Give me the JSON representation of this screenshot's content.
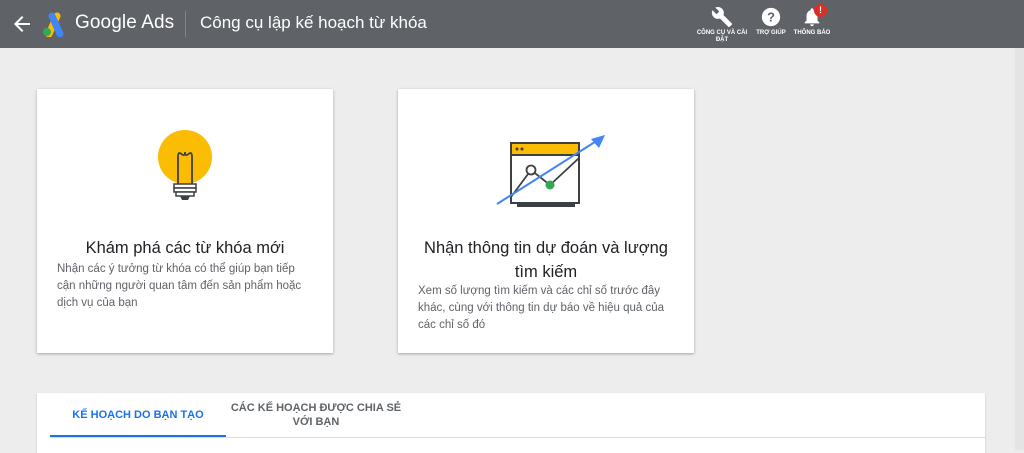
{
  "header": {
    "brand": "Google Ads",
    "page_title": "Công cụ lập kế hoạch từ khóa",
    "tools": [
      {
        "label": "CÔNG CỤ VÀ CÀI ĐẶT",
        "icon": "wrench-icon"
      },
      {
        "label": "TRỢ GIÚP",
        "icon": "help-icon"
      },
      {
        "label": "THÔNG BÁO",
        "icon": "bell-icon",
        "badge": "!"
      }
    ]
  },
  "cards": [
    {
      "title": "Khám phá các từ khóa mới",
      "description": "Nhận các ý tưởng từ khóa có thể giúp bạn tiếp cận những người quan tâm đến sản phẩm hoặc dịch vụ của bạn",
      "icon": "lightbulb-icon"
    },
    {
      "title": "Nhận thông tin dự đoán và lượng tìm kiếm",
      "description": "Xem số lượng tìm kiếm và các chỉ số trước đây khác, cùng với thông tin dự báo về hiệu quả của các chỉ số đó",
      "icon": "forecast-chart-icon"
    }
  ],
  "tabs": [
    {
      "label": "KẾ HOẠCH DO BẠN TẠO",
      "active": true
    },
    {
      "label": "CÁC KẾ HOẠCH ĐƯỢC CHIA SẺ VỚI BẠN",
      "active": false
    }
  ],
  "colors": {
    "topbar": "#5f6368",
    "accent": "#1a73e8",
    "bulb": "#fbbc04",
    "badge": "#d93025",
    "green_dot": "#34a853"
  }
}
